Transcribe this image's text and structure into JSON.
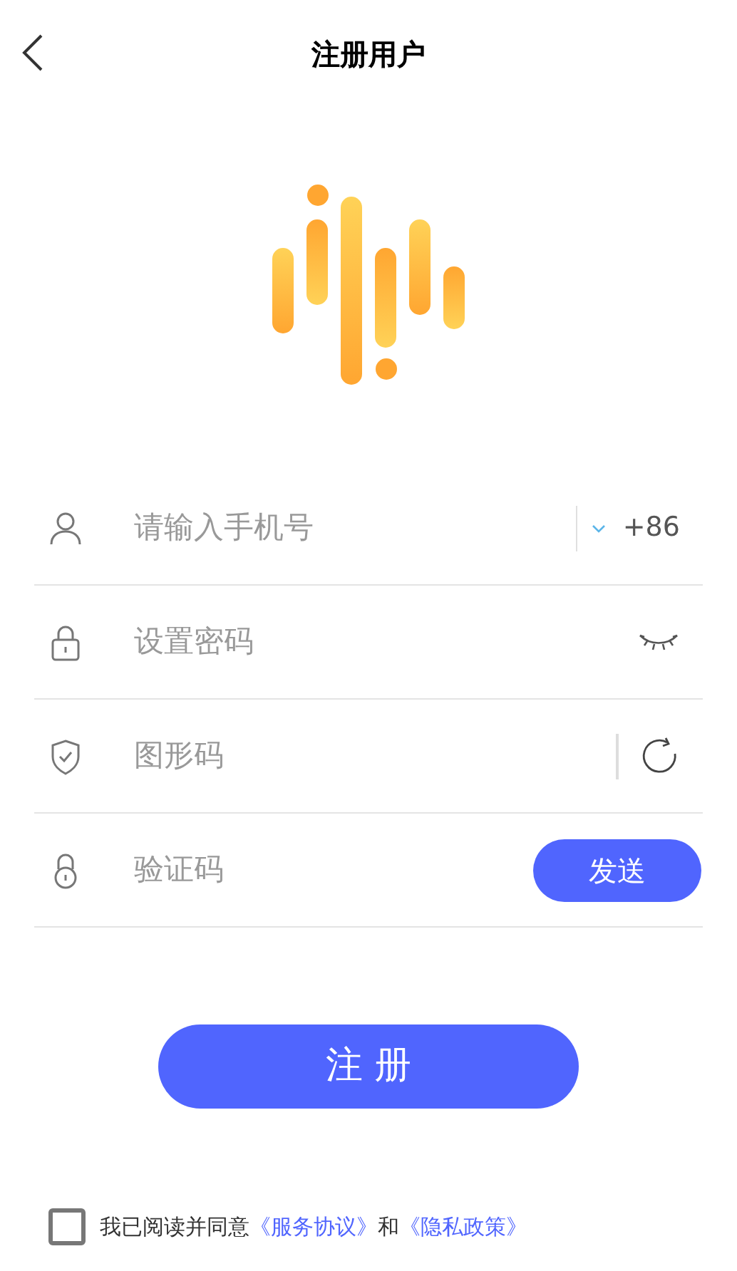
{
  "header": {
    "title": "注册用户"
  },
  "fields": [
    {
      "kind": "phone",
      "placeholder": "请输入手机号",
      "country_code": "+86"
    },
    {
      "kind": "password",
      "placeholder": "设置密码"
    },
    {
      "kind": "captcha",
      "placeholder": "图形码"
    },
    {
      "kind": "code",
      "placeholder": "验证码",
      "button": "发送"
    }
  ],
  "submit_button": "注 册",
  "agreement": {
    "checked": false,
    "text": "我已阅读并同意",
    "terms_link": "《服务协议》",
    "conjunction": "和",
    "privacy_link": "《隐私政策》"
  }
}
